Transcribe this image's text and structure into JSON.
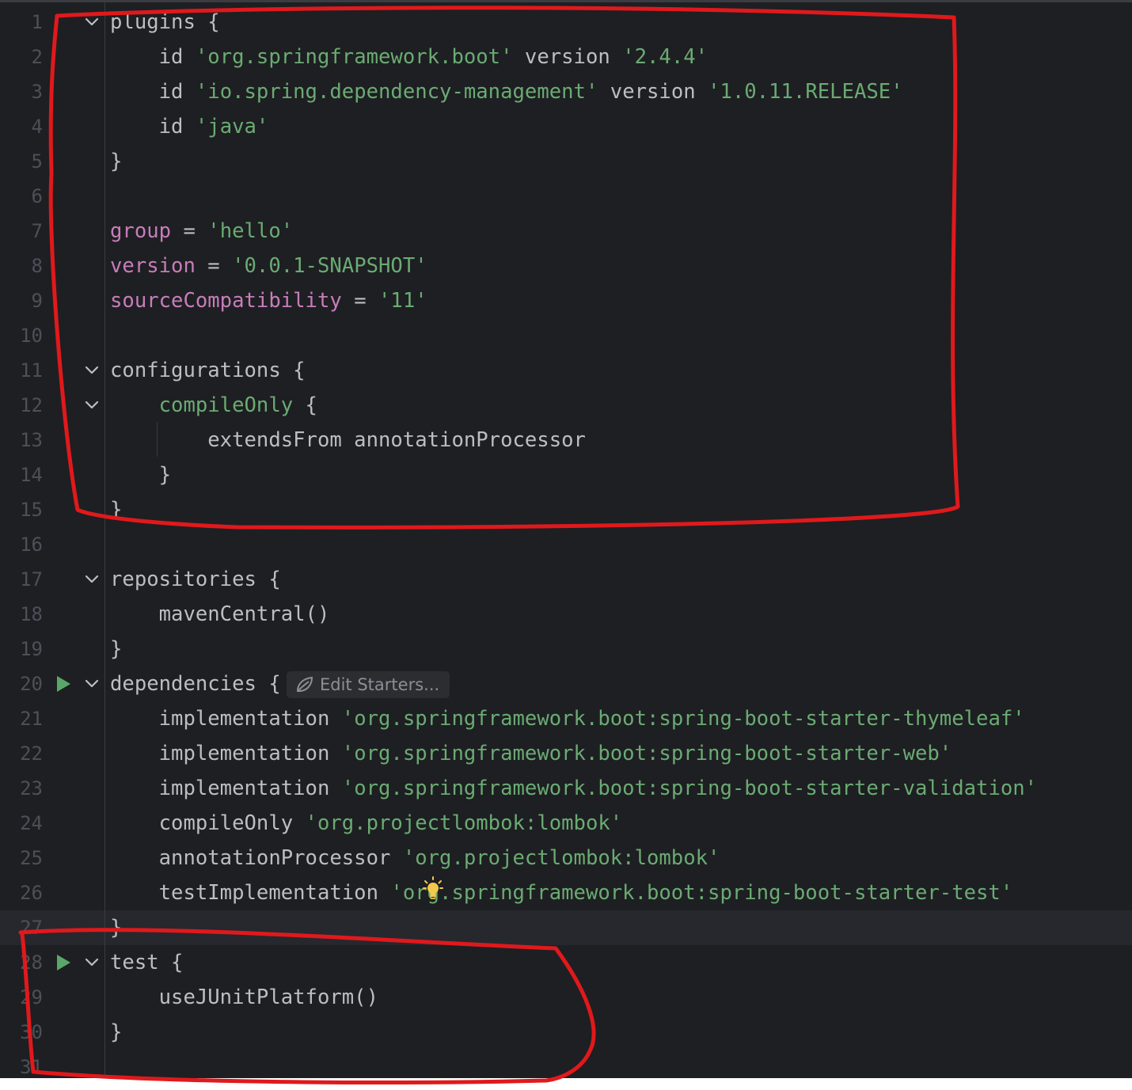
{
  "editor": {
    "caret_line": 27,
    "inlay_hint": {
      "label": "Edit Starters...",
      "icon": "spring-leaf-icon"
    },
    "intention_icon": "lightbulb-icon",
    "lines": [
      {
        "num": "1",
        "fold": true,
        "run": false,
        "tokens": [
          {
            "t": "plugins {",
            "c": "plain"
          }
        ]
      },
      {
        "num": "2",
        "fold": false,
        "run": false,
        "tokens": [
          {
            "t": "    id ",
            "c": "plain"
          },
          {
            "t": "'org.springframework.boot'",
            "c": "str"
          },
          {
            "t": " version ",
            "c": "plain"
          },
          {
            "t": "'2.4.4'",
            "c": "str"
          }
        ]
      },
      {
        "num": "3",
        "fold": false,
        "run": false,
        "tokens": [
          {
            "t": "    id ",
            "c": "plain"
          },
          {
            "t": "'io.spring.dependency-management'",
            "c": "str"
          },
          {
            "t": " version ",
            "c": "plain"
          },
          {
            "t": "'1.0.11.RELEASE'",
            "c": "str"
          }
        ]
      },
      {
        "num": "4",
        "fold": false,
        "run": false,
        "tokens": [
          {
            "t": "    id ",
            "c": "plain"
          },
          {
            "t": "'java'",
            "c": "str"
          }
        ]
      },
      {
        "num": "5",
        "fold": false,
        "run": false,
        "tokens": [
          {
            "t": "}",
            "c": "plain"
          }
        ]
      },
      {
        "num": "6",
        "fold": false,
        "run": false,
        "tokens": []
      },
      {
        "num": "7",
        "fold": false,
        "run": false,
        "tokens": [
          {
            "t": "group",
            "c": "prop"
          },
          {
            "t": " = ",
            "c": "plain"
          },
          {
            "t": "'hello'",
            "c": "str"
          }
        ]
      },
      {
        "num": "8",
        "fold": false,
        "run": false,
        "tokens": [
          {
            "t": "version",
            "c": "prop"
          },
          {
            "t": " = ",
            "c": "plain"
          },
          {
            "t": "'0.0.1-SNAPSHOT'",
            "c": "str"
          }
        ]
      },
      {
        "num": "9",
        "fold": false,
        "run": false,
        "tokens": [
          {
            "t": "sourceCompatibility",
            "c": "prop"
          },
          {
            "t": " = ",
            "c": "plain"
          },
          {
            "t": "'11'",
            "c": "str"
          }
        ]
      },
      {
        "num": "10",
        "fold": false,
        "run": false,
        "tokens": []
      },
      {
        "num": "11",
        "fold": true,
        "run": false,
        "tokens": [
          {
            "t": "configurations {",
            "c": "plain"
          }
        ]
      },
      {
        "num": "12",
        "fold": true,
        "run": false,
        "tokens": [
          {
            "t": "    ",
            "c": "plain"
          },
          {
            "t": "compileOnly",
            "c": "cfg"
          },
          {
            "t": " {",
            "c": "plain"
          }
        ]
      },
      {
        "num": "13",
        "fold": false,
        "run": false,
        "tokens": [
          {
            "t": "        extendsFrom annotationProcessor",
            "c": "plain"
          }
        ]
      },
      {
        "num": "14",
        "fold": false,
        "run": false,
        "tokens": [
          {
            "t": "    }",
            "c": "plain"
          }
        ]
      },
      {
        "num": "15",
        "fold": false,
        "run": false,
        "tokens": [
          {
            "t": "}",
            "c": "plain"
          }
        ]
      },
      {
        "num": "16",
        "fold": false,
        "run": false,
        "tokens": []
      },
      {
        "num": "17",
        "fold": true,
        "run": false,
        "tokens": [
          {
            "t": "repositories {",
            "c": "plain"
          }
        ]
      },
      {
        "num": "18",
        "fold": false,
        "run": false,
        "tokens": [
          {
            "t": "    mavenCentral()",
            "c": "plain"
          }
        ]
      },
      {
        "num": "19",
        "fold": false,
        "run": false,
        "tokens": [
          {
            "t": "}",
            "c": "plain"
          }
        ]
      },
      {
        "num": "20",
        "fold": true,
        "run": true,
        "tokens": [
          {
            "t": "dependencies {",
            "c": "plain"
          }
        ]
      },
      {
        "num": "21",
        "fold": false,
        "run": false,
        "tokens": [
          {
            "t": "    implementation ",
            "c": "plain"
          },
          {
            "t": "'org.springframework.boot:spring-boot-starter-thymeleaf'",
            "c": "str"
          }
        ]
      },
      {
        "num": "22",
        "fold": false,
        "run": false,
        "tokens": [
          {
            "t": "    implementation ",
            "c": "plain"
          },
          {
            "t": "'org.springframework.boot:spring-boot-starter-web'",
            "c": "str"
          }
        ]
      },
      {
        "num": "23",
        "fold": false,
        "run": false,
        "tokens": [
          {
            "t": "    implementation ",
            "c": "plain"
          },
          {
            "t": "'org.springframework.boot:spring-boot-starter-validation'",
            "c": "str"
          }
        ]
      },
      {
        "num": "24",
        "fold": false,
        "run": false,
        "tokens": [
          {
            "t": "    compileOnly ",
            "c": "plain"
          },
          {
            "t": "'org.projectlombok:lombok'",
            "c": "str"
          }
        ]
      },
      {
        "num": "25",
        "fold": false,
        "run": false,
        "tokens": [
          {
            "t": "    annotationProcessor ",
            "c": "plain"
          },
          {
            "t": "'org.projectlombok:lombok'",
            "c": "str"
          }
        ]
      },
      {
        "num": "26",
        "fold": false,
        "run": false,
        "tokens": [
          {
            "t": "    testImplementation ",
            "c": "plain"
          },
          {
            "t": "'org.springframework.boot:spring-boot-starter-test'",
            "c": "str"
          }
        ]
      },
      {
        "num": "27",
        "fold": false,
        "run": false,
        "tokens": [
          {
            "t": "}",
            "c": "plain"
          }
        ]
      },
      {
        "num": "28",
        "fold": true,
        "run": true,
        "tokens": [
          {
            "t": "test {",
            "c": "plain"
          }
        ]
      },
      {
        "num": "29",
        "fold": false,
        "run": false,
        "tokens": [
          {
            "t": "    useJUnitPlatform()",
            "c": "plain"
          }
        ]
      },
      {
        "num": "30",
        "fold": false,
        "run": false,
        "tokens": [
          {
            "t": "}",
            "c": "plain"
          }
        ]
      },
      {
        "num": "31",
        "fold": false,
        "run": false,
        "tokens": []
      }
    ]
  },
  "annotation_color": "#e0191c"
}
